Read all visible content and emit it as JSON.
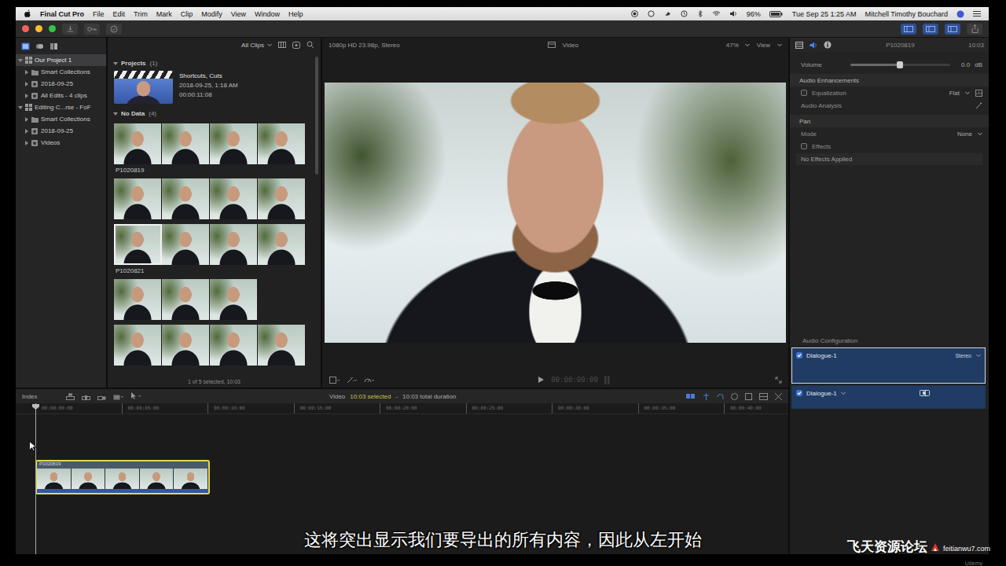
{
  "menubar": {
    "app": "Final Cut Pro",
    "menus": [
      "File",
      "Edit",
      "Trim",
      "Mark",
      "Clip",
      "Modify",
      "View",
      "Window",
      "Help"
    ],
    "battery": "96%",
    "clock": "Tue Sep 25  1:25 AM",
    "user": "Mitchell Timothy Bouchard"
  },
  "libraries": [
    {
      "label": "Our Project 1",
      "depth": 0,
      "kind": "library",
      "expanded": true,
      "selected": true
    },
    {
      "label": "Smart Collections",
      "depth": 1,
      "kind": "folder",
      "expanded": false,
      "selected": false
    },
    {
      "label": "2018-09-25",
      "depth": 1,
      "kind": "event",
      "expanded": false,
      "selected": false
    },
    {
      "label": "All Edits - 4 clips",
      "depth": 1,
      "kind": "event",
      "expanded": false,
      "selected": false
    },
    {
      "label": "Editing C...rse - FoF",
      "depth": 0,
      "kind": "library",
      "expanded": true,
      "selected": false
    },
    {
      "label": "Smart Collections",
      "depth": 1,
      "kind": "folder",
      "expanded": false,
      "selected": false
    },
    {
      "label": "2018-09-25",
      "depth": 1,
      "kind": "event",
      "expanded": false,
      "selected": false
    },
    {
      "label": "Videos",
      "depth": 1,
      "kind": "event",
      "expanded": false,
      "selected": false
    }
  ],
  "browser": {
    "filter": "All Clips",
    "projects": {
      "title": "Projects",
      "count": "(1)",
      "expanded": true,
      "items": [
        {
          "name": "Shortcuts, Cuts",
          "date": "2018-09-25, 1:18 AM",
          "duration": "00:00:11:08"
        }
      ]
    },
    "clips": {
      "title": "No Data",
      "count": "(4)",
      "expanded": true,
      "rows": [
        {
          "frames": 4,
          "label": "P1020819",
          "marked": false
        },
        {
          "frames": 4,
          "marked": false
        },
        {
          "frames": 4,
          "label": "P1020821",
          "marked": true
        },
        {
          "frames": 3,
          "marked": false
        },
        {
          "frames": 4,
          "marked": false
        }
      ]
    },
    "status": "1 of 5 selected, 10:03"
  },
  "viewer": {
    "format": "1080p HD 23.98p, Stereo",
    "role": "Video",
    "zoom": "47%",
    "view": "View",
    "timecode": "00:00:00:00"
  },
  "inspector": {
    "clip": "P1020819",
    "duration": "10:03",
    "tabs": [
      {
        "kind": "video",
        "selected": false
      },
      {
        "kind": "audio",
        "selected": true
      },
      {
        "kind": "info",
        "selected": false
      }
    ],
    "rows": [
      {
        "kind": "slider",
        "label": "Volume",
        "value": "0.0",
        "unit": "dB",
        "level": 0.5
      },
      {
        "kind": "header",
        "label": "Audio Enhancements"
      },
      {
        "kind": "check",
        "label": "Equalization",
        "checked": false,
        "disabled": false,
        "value": "Flat"
      },
      {
        "kind": "action",
        "label": "Audio Analysis"
      },
      {
        "kind": "header",
        "label": "Pan"
      },
      {
        "kind": "plain",
        "label": "Mode",
        "value": "None"
      },
      {
        "kind": "check",
        "label": "Effects",
        "checked": false,
        "disabled": true
      },
      {
        "kind": "note",
        "label": "No Effects Applied"
      }
    ],
    "config": {
      "title": "Audio Configuration",
      "channels": [
        {
          "label": "Dialogue-1",
          "checked": true,
          "selected": true,
          "value": "Stereo"
        },
        {
          "label": "Dialogue-1",
          "checked": true,
          "selected": false
        }
      ]
    }
  },
  "timeline": {
    "index": "Index",
    "role": "Video",
    "selected": "10:03 selected",
    "separator": "-",
    "total": "10:03 total duration",
    "ticks": [
      "00:00:00:00",
      "00:00:05:00",
      "00:00:10:00",
      "00:00:15:00",
      "00:00:20:00",
      "00:00:25:00",
      "00:00:30:00",
      "00:00:35:00",
      "00:00:40:00"
    ],
    "clip": {
      "label": "P1020819",
      "frames": 5,
      "selected": true
    }
  },
  "overlay": {
    "subtitle": "这将突出显示我们要导出的所有内容，因此从左开始",
    "watermark": {
      "name": "飞天资源论坛",
      "url": "feitianwu7.com"
    },
    "brand": "Udemy"
  }
}
